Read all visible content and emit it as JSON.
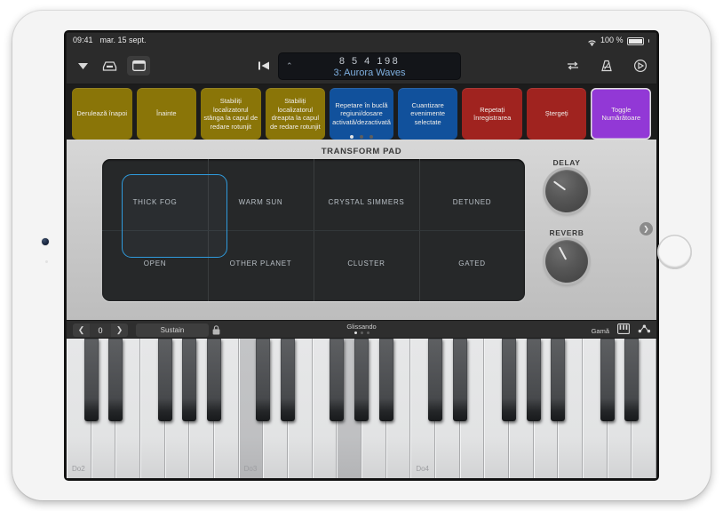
{
  "status_bar": {
    "time": "09:41",
    "date": "mar. 15 sept.",
    "wifi_icon": "wifi-icon",
    "battery_percent": "100 %",
    "battery_icon": "battery-full-icon"
  },
  "toolbar": {
    "left_icons": [
      {
        "name": "chevron-down-icon",
        "glyph": "▼"
      },
      {
        "name": "library-tray-icon",
        "glyph": "tray"
      },
      {
        "name": "view-toggle-icon",
        "glyph": "rect"
      }
    ],
    "transport": [
      {
        "name": "rewind-to-start-button",
        "glyph": "⏮"
      },
      {
        "name": "play-button",
        "glyph": "▶"
      },
      {
        "name": "record-button",
        "glyph": "●"
      }
    ],
    "lcd": {
      "chevron": "⌃",
      "counter": "8 5 4 198",
      "patch": "3: Aurora Waves"
    },
    "right_icons": [
      {
        "name": "cycle-loop-icon",
        "glyph": "⇄"
      },
      {
        "name": "metronome-icon",
        "glyph": "metronome"
      },
      {
        "name": "settings-icon",
        "glyph": "gear"
      }
    ]
  },
  "command_strip": {
    "buttons": [
      {
        "label": "Derulează înapoi",
        "color": "#8a7508",
        "selected": false
      },
      {
        "label": "Înainte",
        "color": "#8a7508",
        "selected": false
      },
      {
        "label": "Stabiliți localizatorul stânga la capul de redare rotunjit",
        "color": "#8a7508",
        "selected": false
      },
      {
        "label": "Stabiliți localizatorul dreapta la capul de redare rotunjit",
        "color": "#8a7508",
        "selected": false
      },
      {
        "label": "Repetare în buclă regiuni/dosare activată/dezactivată",
        "color": "#11519c",
        "selected": false
      },
      {
        "label": "Cuantizare evenimente selectate",
        "color": "#11519c",
        "selected": false
      },
      {
        "label": "Repetați înregistrarea",
        "color": "#a0231f",
        "selected": false
      },
      {
        "label": "Ștergeți",
        "color": "#a0231f",
        "selected": false
      },
      {
        "label": "Toggle Numărătoare",
        "color": "#9238d6",
        "selected": true
      }
    ],
    "page_dots": {
      "count": 3,
      "active_index": 0
    }
  },
  "instrument_plate": {
    "title": "TRANSFORM PAD",
    "pad_labels_top": [
      "THICK FOG",
      "WARM SUN",
      "CRYSTAL SIMMERS",
      "DETUNED"
    ],
    "pad_labels_bottom": [
      "OPEN",
      "OTHER PLANET",
      "CLUSTER",
      "GATED"
    ],
    "cursor_color": "#2f9bdd",
    "knobs": [
      {
        "label": "DELAY",
        "angle": -54
      },
      {
        "label": "REVERB",
        "angle": -28
      }
    ],
    "next_arrow": "❯"
  },
  "keyboard_bar": {
    "octave_prev": "❮",
    "octave_value": "0",
    "octave_next": "❯",
    "sustain_label": "Sustain",
    "lock_icon": "lock-icon",
    "glissando_label": "Glissando",
    "glissando_dots": {
      "count": 3,
      "active_index": 0
    },
    "scale_label": "Gamă",
    "keyboard_layout_icon": "keyboard-icon",
    "arpeggiator_icon": "arpeggiator-icon"
  },
  "piano": {
    "start_note": "Do2",
    "white_key_count": 24,
    "octave_labels": [
      {
        "label": "Do2",
        "white_index": 0
      },
      {
        "label": "Do3",
        "white_index": 7
      },
      {
        "label": "Do4",
        "white_index": 14
      }
    ],
    "highlighted_white_indices": [
      7,
      11
    ],
    "black_key_offsets": [
      0,
      1,
      3,
      4,
      5
    ]
  }
}
